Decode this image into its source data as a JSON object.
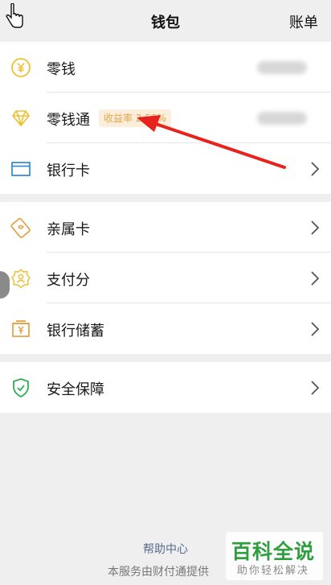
{
  "header": {
    "title": "钱包",
    "bill": "账单",
    "cursor_icon": "hand-pointer-icon"
  },
  "group1": [
    {
      "label": "零钱",
      "icon": "yuan-coin-icon"
    },
    {
      "label": "零钱通",
      "icon": "diamond-icon",
      "badge": "收益率 2.52%"
    },
    {
      "label": "银行卡",
      "icon": "bank-card-icon"
    }
  ],
  "group2": [
    {
      "label": "亲属卡",
      "icon": "family-card-icon"
    },
    {
      "label": "支付分",
      "icon": "pay-score-icon"
    },
    {
      "label": "银行储蓄",
      "icon": "bank-deposit-icon"
    }
  ],
  "group3": [
    {
      "label": "安全保障",
      "icon": "shield-icon"
    }
  ],
  "footer": {
    "help": "帮助中心",
    "service": "本服务由财付通提供"
  },
  "watermark": {
    "big": "百科全说",
    "small": "助你轻松解决"
  },
  "colors": {
    "accent_yellow": "#f0c030",
    "accent_blue": "#3a8fd0",
    "accent_orange": "#e5a040",
    "accent_green": "#2fae57",
    "badge_text": "#e3a64a",
    "link": "#5a6b8c"
  }
}
